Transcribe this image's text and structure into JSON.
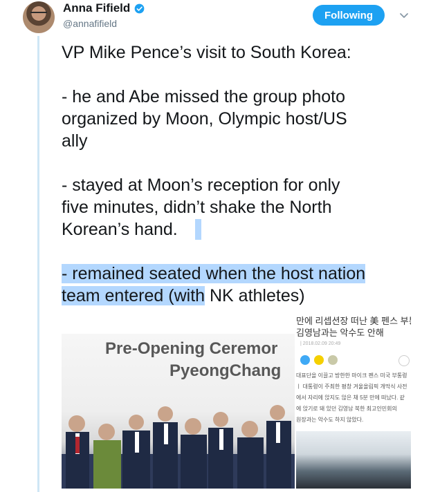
{
  "user": {
    "name": "Anna Fifield",
    "handle": "@annafifield",
    "follow_label": "Following"
  },
  "colors": {
    "accent": "#1da1f2",
    "selection": "#b3d7fe",
    "thread_line": "#cfe6f5"
  },
  "icons": {
    "verified": "verified-badge-icon",
    "caret": "chevron-down-icon"
  },
  "tweet": {
    "line1": "VP Mike Pence’s visit to South Korea:",
    "line2": "- he and Abe missed the group photo",
    "line3": "organized by Moon, Olympic host/US",
    "line4": "ally",
    "line5": "- stayed at Moon’s reception for only",
    "line6": "five minutes, didn’t shake the North",
    "line7": "Korean’s hand.",
    "line8_selected": "- remained seated when the host nation",
    "line9_selected": "team entered (with",
    "line9_rest": " NK athletes)"
  },
  "media_left": {
    "banner_line1": "Pre-Opening Ceremor",
    "banner_line2": "PyeongChang"
  },
  "media_right": {
    "headline_line1": "만에 리셉션장 떠난 美 펜스 부통",
    "headline_line2": "김영남과는 악수도 안해",
    "date": "| 2018.02.09 20:49",
    "body_lines": [
      "대표단을 이끌고 방한한 마이크 펜스 미국 부통령",
      "ㅣ 대통령이 주최한 평창 겨울올림픽 개막식 사전",
      "에서 자리에 앉지도 않은 채 5분 만에 떠났다. 같",
      "에 앉기로 돼 있던 김영남 북한 최고인민회의",
      "원장과는 악수도 하지 않았다."
    ]
  }
}
